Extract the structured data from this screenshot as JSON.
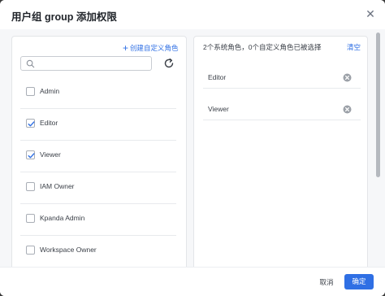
{
  "dialog": {
    "title": "用户组 group 添加权限",
    "close_icon": "close-icon"
  },
  "left_panel": {
    "create_link_label": "创建自定义角色",
    "search": {
      "placeholder": "",
      "value": ""
    },
    "roles": [
      {
        "label": "Admin",
        "checked": false
      },
      {
        "label": "Editor",
        "checked": true
      },
      {
        "label": "Viewer",
        "checked": true
      },
      {
        "label": "IAM Owner",
        "checked": false
      },
      {
        "label": "Kpanda Admin",
        "checked": false
      },
      {
        "label": "Workspace Owner",
        "checked": false
      }
    ]
  },
  "right_panel": {
    "summary": "2个系统角色，0个自定义角色已被选择",
    "clear_label": "清空",
    "selected": [
      {
        "label": "Editor"
      },
      {
        "label": "Viewer"
      }
    ]
  },
  "footer": {
    "cancel_label": "取消",
    "confirm_label": "确定"
  },
  "colors": {
    "accent": "#2f6fe4",
    "text": "#3a3f47",
    "border": "#e3e5e8"
  }
}
